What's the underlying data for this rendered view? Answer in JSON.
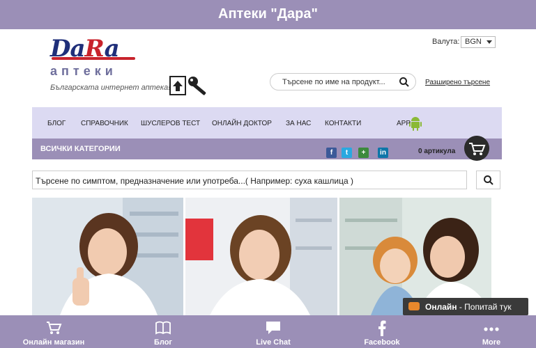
{
  "app": {
    "title": "Аптеки \"Дара\""
  },
  "logo": {
    "brand_da": "Da",
    "brand_r": "R",
    "brand_a": "a",
    "sub": "аптеки",
    "tagline": "Българската интернет аптека!"
  },
  "currency": {
    "label": "Валута:",
    "selected": "BGN"
  },
  "search": {
    "placeholder": "Търсене по име на продукт...",
    "advanced": "Разширено търсене"
  },
  "nav": {
    "items": [
      "БЛОГ",
      "СПРАВОЧНИК",
      "ШУСЛЕРОВ ТЕСТ",
      "ОНЛАЙН ДОКТОР",
      "ЗА НАС",
      "КОНТАКТИ",
      "APP"
    ]
  },
  "categories": {
    "label": "ВСИЧКИ КАТЕГОРИИ"
  },
  "social": {
    "icons": [
      "facebook-icon",
      "twitter-icon",
      "google-plus-icon",
      "linkedin-icon"
    ]
  },
  "cart": {
    "count": "0 артикула"
  },
  "symptom_search": {
    "placeholder": "Търсене по симптом, предназначение или употреба...( Например: суха кашлица )"
  },
  "chat": {
    "status": "Онлайн",
    "text": " - Попитай тук"
  },
  "tabs": [
    {
      "label": "Онлайн магазин",
      "icon": "cart-icon"
    },
    {
      "label": "Блог",
      "icon": "book-icon"
    },
    {
      "label": "Live Chat",
      "icon": "chat-icon"
    },
    {
      "label": "Facebook",
      "icon": "facebook-icon"
    },
    {
      "label": "More",
      "icon": "more-icon"
    }
  ],
  "colors": {
    "accent": "#9b8fb7",
    "nav_bg": "#dcdaf2",
    "logo_blue": "#1f2f7a",
    "logo_red": "#c8232c"
  }
}
